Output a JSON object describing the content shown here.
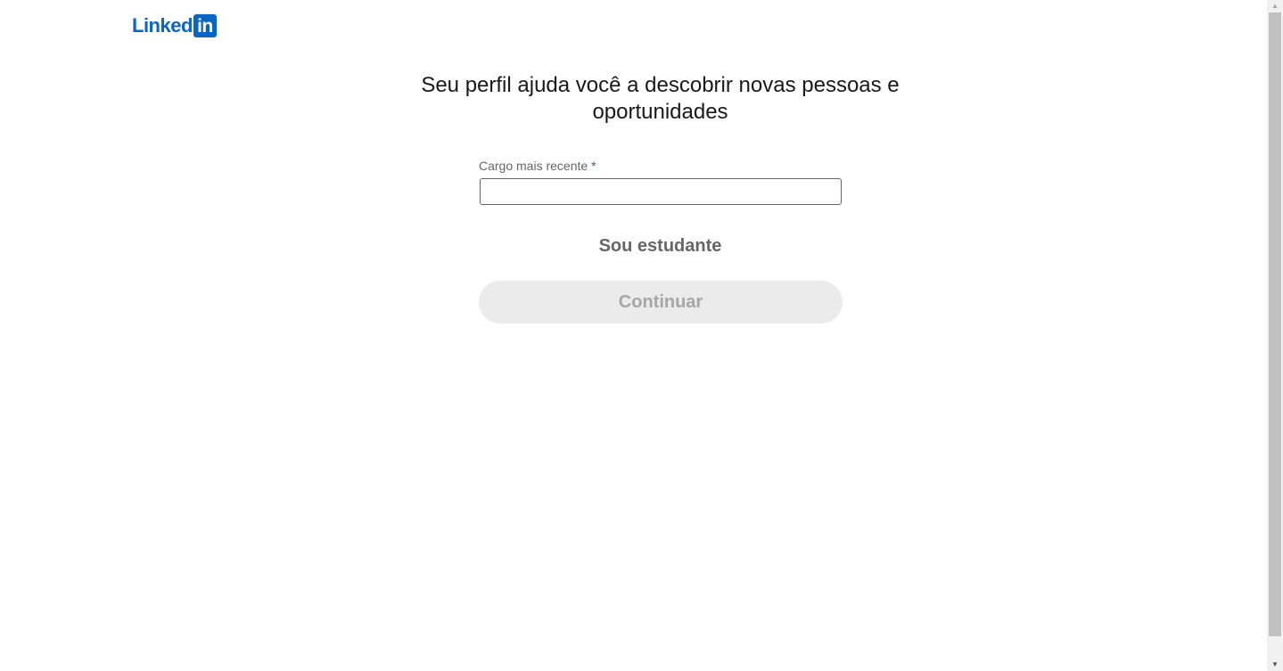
{
  "header": {
    "logo_text": "Linked",
    "logo_box_text": "in"
  },
  "main": {
    "headline": "Seu perfil ajuda você a descobrir novas pessoas e oportunidades",
    "field_label": "Cargo mais recente",
    "required_marker": "*",
    "field_value": "",
    "student_link": "Sou estudante",
    "continue_label": "Continuar"
  },
  "scrollbar": {
    "up_icon": "▲",
    "down_icon": "▼"
  },
  "colors": {
    "brand": "#0a66c2",
    "text_primary": "#191919",
    "text_secondary": "#666666",
    "button_disabled_bg": "#ebebeb",
    "button_disabled_text": "#a6a6a6"
  }
}
